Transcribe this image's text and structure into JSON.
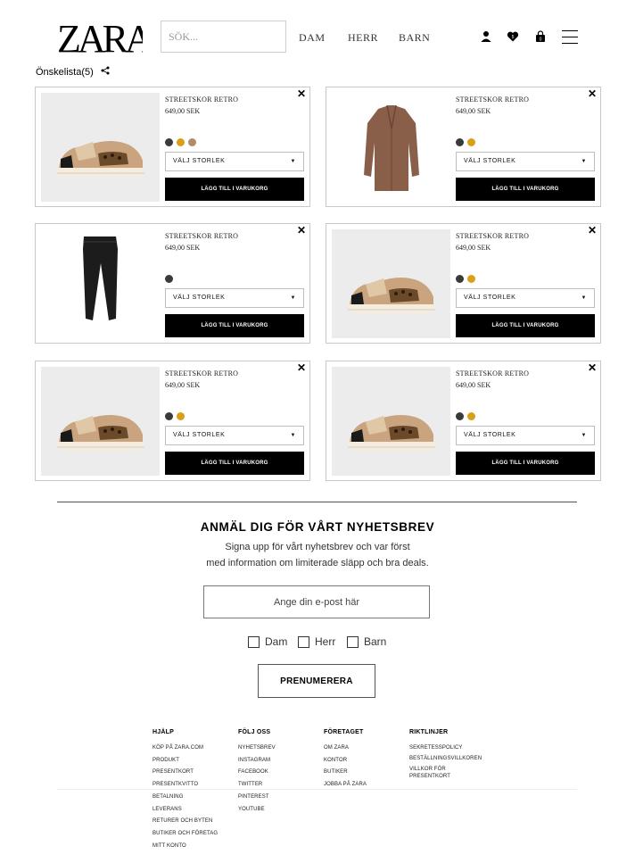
{
  "header": {
    "logo": "ZARA",
    "search_placeholder": "SÖK...",
    "nav": [
      "DAM",
      "HERR",
      "BARN"
    ]
  },
  "wishlist": {
    "title": "Önskelista(5)"
  },
  "products": [
    {
      "name": "STREETSKOR RETRO",
      "price": "649,00 SEK",
      "image": "sneaker",
      "swatches": [
        "#3a3a3a",
        "#d8a017",
        "#b08b6c"
      ],
      "size_label": "VÄLJ STORLEK",
      "add_label": "LÄGG TILL I VARUKORG"
    },
    {
      "name": "STREETSKOR RETRO",
      "price": "649,00 SEK",
      "image": "coat",
      "swatches": [
        "#3a3a3a",
        "#d8a017"
      ],
      "size_label": "VÄLJ STORLEK",
      "add_label": "LÄGG TILL I VARUKORG"
    },
    {
      "name": "STREETSKOR RETRO",
      "price": "649,00 SEK",
      "image": "trousers",
      "swatches": [
        "#3a3a3a"
      ],
      "size_label": "VÄLJ STORLEK",
      "add_label": "LÄGG TILL I VARUKORG"
    },
    {
      "name": "STREETSKOR RETRO",
      "price": "649,00 SEK",
      "image": "sneaker",
      "swatches": [
        "#3a3a3a",
        "#d8a017"
      ],
      "size_label": "VÄLJ STORLEK",
      "add_label": "LÄGG TILL I VARUKORG"
    },
    {
      "name": "STREETSKOR RETRO",
      "price": "649,00 SEK",
      "image": "sneaker",
      "swatches": [
        "#3a3a3a",
        "#d8a017"
      ],
      "size_label": "VÄLJ STORLEK",
      "add_label": "LÄGG TILL I VARUKORG"
    },
    {
      "name": "STREETSKOR RETRO",
      "price": "649,00 SEK",
      "image": "sneaker",
      "swatches": [
        "#3a3a3a",
        "#d8a017"
      ],
      "size_label": "VÄLJ STORLEK",
      "add_label": "LÄGG TILL I VARUKORG"
    }
  ],
  "newsletter": {
    "title": "ANMÄL DIG FÖR VÅRT NYHETSBREV",
    "line1": "Signa upp för vårt nyhetsbrev och var först",
    "line2": "med information om limiterade släpp och bra deals.",
    "email_placeholder": "Ange din e-post här",
    "options": [
      "Dam",
      "Herr",
      "Barn"
    ],
    "button": "PRENUMERERA"
  },
  "footer": {
    "columns": [
      {
        "title": "HJÄLP",
        "links": [
          "Köp på zara.com",
          "Produkt",
          "Presentkort",
          "Presentkvitto",
          "Betalning",
          "Leverans",
          "Returer och byten",
          "Butiker och företag",
          "Mitt konto"
        ]
      },
      {
        "title": "FÖLJ OSS",
        "links": [
          "Nyhetsbrev",
          "Instagram",
          "Facebook",
          "Twitter",
          "Pinterest",
          "Youtube"
        ]
      },
      {
        "title": "FÖRETAGET",
        "links": [
          "Om Zara",
          "Kontor",
          "Butiker",
          "Jobba på Zara"
        ]
      },
      {
        "title": "RIKTLINJER",
        "links": [
          "Sekretesspolicy",
          "Beställningsvillkoren",
          "Villkor för presentkort"
        ]
      }
    ]
  }
}
